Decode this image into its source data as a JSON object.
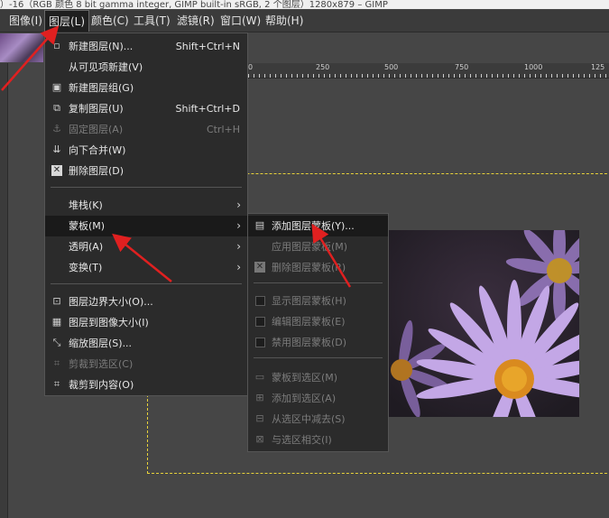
{
  "titlebar": {
    "text": "）-16（RGB 颜色 8 bit gamma integer, GIMP built-in sRGB, 2 个图层）1280x879 – GIMP"
  },
  "menubar": {
    "items": [
      "图像(I)",
      "图层(L)",
      "颜色(C)",
      "工具(T)",
      "滤镜(R)",
      "窗口(W)",
      "帮助(H)"
    ],
    "active": "图层(L)"
  },
  "ruler": {
    "ticks": [
      "0",
      "250",
      "500",
      "750",
      "1000",
      "125"
    ]
  },
  "layer_menu": {
    "items": [
      {
        "label": "新建图层(N)...",
        "shortcut": "Shift+Ctrl+N",
        "icon": "new-layer-icon",
        "glyph": "▫",
        "disabled": false
      },
      {
        "label": "从可见项新建(V)",
        "shortcut": "",
        "icon": "",
        "glyph": "",
        "disabled": false
      },
      {
        "label": "新建图层组(G)",
        "shortcut": "",
        "icon": "layer-group-icon",
        "glyph": "▣",
        "disabled": false
      },
      {
        "label": "复制图层(U)",
        "shortcut": "Shift+Ctrl+D",
        "icon": "duplicate-icon",
        "glyph": "⧉",
        "disabled": false
      },
      {
        "label": "固定图层(A)",
        "shortcut": "Ctrl+H",
        "icon": "anchor-icon",
        "glyph": "⚓",
        "disabled": true
      },
      {
        "label": "向下合并(W)",
        "shortcut": "",
        "icon": "merge-down-icon",
        "glyph": "⇊",
        "disabled": false
      },
      {
        "label": "删除图层(D)",
        "shortcut": "",
        "icon": "delete-icon",
        "glyph": "✕",
        "disabled": false
      },
      {
        "label": "堆栈(K)",
        "submenu": true,
        "disabled": false
      },
      {
        "label": "蒙板(M)",
        "submenu": true,
        "disabled": false,
        "highlight": true
      },
      {
        "label": "透明(A)",
        "submenu": true,
        "disabled": false
      },
      {
        "label": "变换(T)",
        "submenu": true,
        "disabled": false
      },
      {
        "label": "图层边界大小(O)...",
        "icon": "boundary-size-icon",
        "glyph": "⊡",
        "disabled": false
      },
      {
        "label": "图层到图像大小(I)",
        "icon": "layer-to-image-icon",
        "glyph": "▦",
        "disabled": false
      },
      {
        "label": "缩放图层(S)...",
        "icon": "scale-icon",
        "glyph": "⤡",
        "disabled": false
      },
      {
        "label": "剪裁到选区(C)",
        "icon": "crop-selection-icon",
        "glyph": "⌗",
        "disabled": true
      },
      {
        "label": "裁剪到内容(O)",
        "icon": "crop-content-icon",
        "glyph": "⌗",
        "disabled": false
      }
    ]
  },
  "mask_menu": {
    "items": [
      {
        "label": "添加图层蒙板(Y)...",
        "icon": "add-mask-icon",
        "glyph": "▤",
        "disabled": false,
        "highlight": true
      },
      {
        "label": "应用图层蒙板(M)",
        "icon": "",
        "glyph": "",
        "disabled": true
      },
      {
        "label": "删除图层蒙板(R)",
        "icon": "delete-mask-icon",
        "glyph": "✕",
        "disabled": true
      },
      {
        "label": "显示图层蒙板(H)",
        "icon": "checkbox",
        "disabled": true
      },
      {
        "label": "编辑图层蒙板(E)",
        "icon": "checkbox",
        "disabled": true
      },
      {
        "label": "禁用图层蒙板(D)",
        "icon": "checkbox",
        "disabled": true
      },
      {
        "label": "蒙板到选区(M)",
        "icon": "mask-to-selection-icon",
        "glyph": "▭",
        "disabled": true
      },
      {
        "label": "添加到选区(A)",
        "icon": "add-selection-icon",
        "glyph": "⊞",
        "disabled": true
      },
      {
        "label": "从选区中减去(S)",
        "icon": "subtract-selection-icon",
        "glyph": "⊟",
        "disabled": true
      },
      {
        "label": "与选区相交(I)",
        "icon": "intersect-selection-icon",
        "glyph": "⊠",
        "disabled": true
      }
    ]
  },
  "colors": {
    "annotation": "#e02020",
    "selection": "#e8d23a",
    "menu_bg": "#2b2b2b",
    "highlight": "#1a1a1a"
  }
}
